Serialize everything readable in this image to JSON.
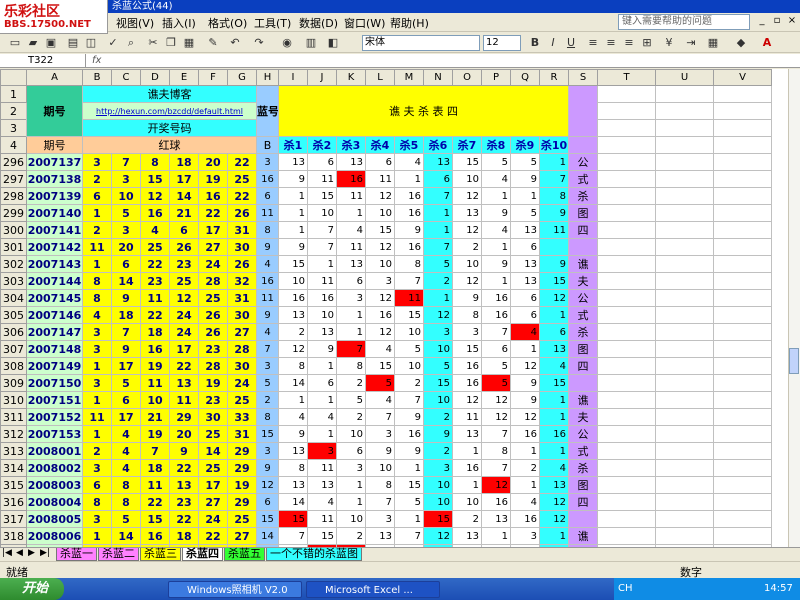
{
  "window": {
    "title": "杀蓝公式(44)",
    "logo_line1": "乐彩社区",
    "logo_line2": "BBS.17500.NET"
  },
  "menu": [
    "视图(V)",
    "插入(I)",
    "格式(O)",
    "工具(T)",
    "数据(D)",
    "窗口(W)",
    "帮助(H)"
  ],
  "help_placeholder": "键入需要帮助的问题",
  "toolbar": {
    "font": "宋体",
    "size": "12",
    "bold": "B",
    "italic": "I",
    "underline": "U"
  },
  "namebox": "T322",
  "fx": "fx",
  "columns": [
    "A",
    "B",
    "C",
    "D",
    "E",
    "F",
    "G",
    "H",
    "I",
    "J",
    "K",
    "L",
    "M",
    "N",
    "O",
    "P",
    "Q",
    "R",
    "S",
    "T",
    "U",
    "V",
    "W"
  ],
  "header": {
    "period": "期号",
    "blog": "谯夫博客",
    "url": "http://hexun.com/bzcdd/default.html",
    "draw_no": "开奖号码",
    "red": "红球",
    "blue": "蓝号",
    "blue_b": "B",
    "table_title": "谯 夫 杀 表 四",
    "kill": [
      "杀1",
      "杀2",
      "杀3",
      "杀4",
      "杀5",
      "杀6",
      "杀7",
      "杀8",
      "杀9",
      "杀10"
    ],
    "row_nums": [
      "1",
      "2",
      "3",
      "4"
    ]
  },
  "side_text": [
    "公",
    "式",
    "杀",
    "图",
    "四",
    "",
    "谯",
    "夫",
    "公",
    "式",
    "杀",
    "图",
    "四",
    "",
    "谯",
    "夫",
    "公",
    "式",
    "杀",
    "图",
    "四",
    "",
    "谯",
    "夫",
    "公",
    "式",
    "杀"
  ],
  "rows": [
    {
      "n": "296",
      "p": "2007137",
      "r": [
        3,
        7,
        8,
        18,
        20,
        22
      ],
      "b": 3,
      "k": [
        13,
        6,
        13,
        6,
        4,
        13,
        15,
        5,
        5,
        1
      ],
      "hl": []
    },
    {
      "n": "297",
      "p": "2007138",
      "r": [
        2,
        3,
        15,
        17,
        19,
        25
      ],
      "b": 16,
      "k": [
        9,
        11,
        16,
        11,
        1,
        6,
        10,
        4,
        9,
        7
      ],
      "hl": [
        2
      ]
    },
    {
      "n": "298",
      "p": "2007139",
      "r": [
        6,
        10,
        12,
        14,
        16,
        22
      ],
      "b": 6,
      "k": [
        1,
        15,
        11,
        12,
        16,
        7,
        12,
        1,
        1,
        8
      ],
      "hl": []
    },
    {
      "n": "299",
      "p": "2007140",
      "r": [
        1,
        5,
        16,
        21,
        22,
        26
      ],
      "b": 11,
      "k": [
        1,
        10,
        1,
        10,
        16,
        1,
        13,
        9,
        5,
        9
      ],
      "hl": []
    },
    {
      "n": "300",
      "p": "2007141",
      "r": [
        2,
        3,
        4,
        6,
        17,
        31
      ],
      "b": 8,
      "k": [
        1,
        7,
        4,
        15,
        9,
        1,
        12,
        4,
        13,
        11
      ],
      "hl": []
    },
    {
      "n": "301",
      "p": "2007142",
      "r": [
        11,
        20,
        25,
        26,
        27,
        30
      ],
      "b": 9,
      "k": [
        9,
        7,
        11,
        12,
        16,
        7,
        2,
        1,
        6,
        ""
      ],
      "hl": []
    },
    {
      "n": "302",
      "p": "2007143",
      "r": [
        1,
        6,
        22,
        23,
        24,
        26
      ],
      "b": 4,
      "k": [
        15,
        1,
        13,
        10,
        8,
        5,
        10,
        9,
        13,
        9
      ],
      "hl": []
    },
    {
      "n": "303",
      "p": "2007144",
      "r": [
        8,
        14,
        23,
        25,
        28,
        32
      ],
      "b": 16,
      "k": [
        10,
        11,
        6,
        3,
        7,
        2,
        12,
        1,
        13,
        15
      ],
      "hl": []
    },
    {
      "n": "304",
      "p": "2007145",
      "r": [
        8,
        9,
        11,
        12,
        25,
        31
      ],
      "b": 11,
      "k": [
        16,
        16,
        3,
        12,
        11,
        1,
        9,
        16,
        6,
        12
      ],
      "hl": [
        4
      ]
    },
    {
      "n": "305",
      "p": "2007146",
      "r": [
        4,
        18,
        22,
        24,
        26,
        30
      ],
      "b": 9,
      "k": [
        13,
        10,
        1,
        16,
        15,
        12,
        8,
        16,
        6,
        1
      ],
      "hl": []
    },
    {
      "n": "306",
      "p": "2007147",
      "r": [
        3,
        7,
        18,
        24,
        26,
        27
      ],
      "b": 4,
      "k": [
        2,
        13,
        1,
        12,
        10,
        3,
        3,
        7,
        4,
        6
      ],
      "hl": [
        8
      ]
    },
    {
      "n": "307",
      "p": "2007148",
      "r": [
        3,
        9,
        16,
        17,
        23,
        28
      ],
      "b": 7,
      "k": [
        12,
        9,
        7,
        4,
        5,
        10,
        15,
        6,
        1,
        13
      ],
      "hl": [
        2
      ]
    },
    {
      "n": "308",
      "p": "2007149",
      "r": [
        1,
        17,
        19,
        22,
        28,
        30
      ],
      "b": 3,
      "k": [
        8,
        1,
        8,
        15,
        10,
        5,
        16,
        5,
        12,
        4
      ],
      "hl": []
    },
    {
      "n": "309",
      "p": "2007150",
      "r": [
        3,
        5,
        11,
        13,
        19,
        24
      ],
      "b": 5,
      "k": [
        14,
        6,
        2,
        5,
        2,
        15,
        16,
        5,
        9,
        15
      ],
      "hl": [
        3,
        7
      ]
    },
    {
      "n": "310",
      "p": "2007151",
      "r": [
        1,
        6,
        10,
        11,
        23,
        25
      ],
      "b": 2,
      "k": [
        1,
        1,
        5,
        4,
        7,
        10,
        12,
        12,
        9,
        1
      ],
      "hl": []
    },
    {
      "n": "311",
      "p": "2007152",
      "r": [
        11,
        17,
        21,
        29,
        30,
        33
      ],
      "b": 8,
      "k": [
        4,
        4,
        2,
        7,
        9,
        2,
        11,
        12,
        12,
        1
      ],
      "hl": []
    },
    {
      "n": "312",
      "p": "2007153",
      "r": [
        1,
        4,
        19,
        20,
        25,
        31
      ],
      "b": 15,
      "k": [
        9,
        1,
        10,
        3,
        16,
        9,
        13,
        7,
        16,
        16
      ],
      "hl": []
    },
    {
      "n": "313",
      "p": "2008001",
      "r": [
        2,
        4,
        7,
        9,
        14,
        29
      ],
      "b": 3,
      "k": [
        13,
        3,
        6,
        9,
        9,
        2,
        1,
        8,
        1,
        1
      ],
      "hl": [
        1
      ]
    },
    {
      "n": "314",
      "p": "2008002",
      "r": [
        3,
        4,
        18,
        22,
        25,
        29
      ],
      "b": 9,
      "k": [
        8,
        11,
        3,
        10,
        1,
        3,
        16,
        7,
        2,
        4
      ],
      "hl": []
    },
    {
      "n": "315",
      "p": "2008003",
      "r": [
        6,
        8,
        11,
        13,
        17,
        19
      ],
      "b": 12,
      "k": [
        13,
        13,
        1,
        8,
        15,
        10,
        1,
        12,
        1,
        13
      ],
      "hl": [
        7
      ]
    },
    {
      "n": "316",
      "p": "2008004",
      "r": [
        8,
        8,
        22,
        23,
        27,
        29
      ],
      "b": 6,
      "k": [
        14,
        4,
        1,
        7,
        5,
        10,
        10,
        16,
        4,
        12
      ],
      "hl": []
    },
    {
      "n": "317",
      "p": "2008005",
      "r": [
        3,
        5,
        15,
        22,
        24,
        25
      ],
      "b": 15,
      "k": [
        15,
        11,
        10,
        3,
        1,
        15,
        2,
        13,
        16,
        12
      ],
      "hl": [
        0,
        5
      ]
    },
    {
      "n": "318",
      "p": "2008006",
      "r": [
        1,
        14,
        16,
        18,
        22,
        27
      ],
      "b": 14,
      "k": [
        7,
        15,
        2,
        13,
        7,
        12,
        13,
        1,
        3,
        1
      ],
      "hl": []
    },
    {
      "n": "319",
      "p": "2008007",
      "r": [
        1,
        13,
        17,
        22,
        23,
        30
      ],
      "b": 11,
      "k": [
        9,
        11,
        11,
        16,
        2,
        9,
        13,
        3,
        8,
        14
      ],
      "hl": [
        1,
        2
      ]
    },
    {
      "n": "320",
      "p": "2008008",
      "r": [
        2,
        15,
        16,
        23,
        26,
        27
      ],
      "b": 5,
      "k": [
        16,
        12,
        13,
        8,
        6,
        13,
        16,
        5,
        3,
        11
      ],
      "hl": [
        7
      ]
    },
    {
      "n": "321",
      "p": "2008009",
      "r": [
        9,
        21,
        29,
        30,
        31,
        32
      ],
      "b": 16,
      "k": [
        16,
        8,
        8,
        3,
        4,
        5,
        14,
        11,
        13,
        15
      ],
      "hl": [
        0
      ]
    },
    {
      "n": "322",
      "p": "2008010",
      "r": [
        "",
        "",
        "",
        "",
        "",
        ""
      ],
      "b": "",
      "k": [
        10,
        5,
        13,
        10,
        11,
        8,
        10,
        8,
        3,
        7
      ],
      "hl": []
    }
  ],
  "sheet_tabs": [
    "杀蓝一",
    "杀蓝二",
    "杀蓝三",
    "杀蓝四",
    "杀蓝五",
    "一个不错的杀蓝图"
  ],
  "status": {
    "left": "就绪",
    "right": "数字"
  },
  "taskbar": {
    "start": "开始",
    "task1": "Windows照相机 V2.0",
    "task2": "Microsoft Excel ...",
    "tray": "CH",
    "time": "14:57"
  },
  "colors": {
    "cyan": "#33ffff",
    "yellow": "#ffff00",
    "green_header": "#ccffcc",
    "orange": "#ffcc99",
    "purple": "#cc99ff",
    "red": "#ff0000",
    "blue_col": "#99ccff"
  }
}
